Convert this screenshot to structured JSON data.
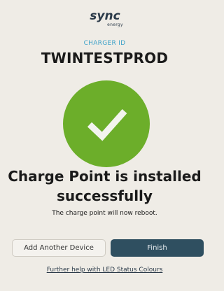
{
  "brand": {
    "logo_text": "sync",
    "logo_subtext": "energy",
    "accent_color": "#3aa0c8",
    "success_color": "#6cae2a"
  },
  "charger": {
    "label": "CHARGER ID",
    "id": "TWINTESTPROD"
  },
  "status": {
    "icon": "checkmark-icon",
    "headline_line1": "Charge Point is installed",
    "headline_line2": "successfully",
    "subtext": "The charge point will now reboot."
  },
  "actions": {
    "add_device_label": "Add Another Device",
    "finish_label": "Finish",
    "primary_color": "#2f4f60"
  },
  "help": {
    "link_text": "Further help with LED Status Colours"
  }
}
